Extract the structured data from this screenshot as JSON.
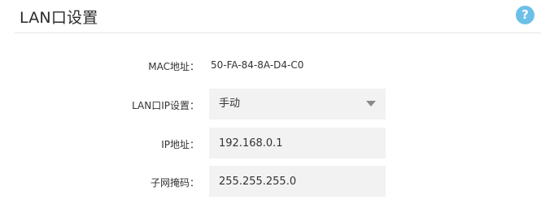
{
  "header": {
    "title": "LAN口设置",
    "help_icon": "?"
  },
  "settings": {
    "mac": {
      "label": "MAC地址：",
      "value": "50-FA-84-8A-D4-C0"
    },
    "ip_mode": {
      "label": "LAN口IP设置：",
      "value": "手动"
    },
    "ip": {
      "label": "IP地址：",
      "value": "192.168.0.1"
    },
    "mask": {
      "label": "子网掩码：",
      "value": "255.255.255.0"
    }
  },
  "icons": {
    "help": "help-icon",
    "dropdown": "chevron-down-icon"
  },
  "colors": {
    "help_bg": "#6cc0e8",
    "field_bg": "#f2f2f2",
    "divider": "#e5e5e5"
  }
}
